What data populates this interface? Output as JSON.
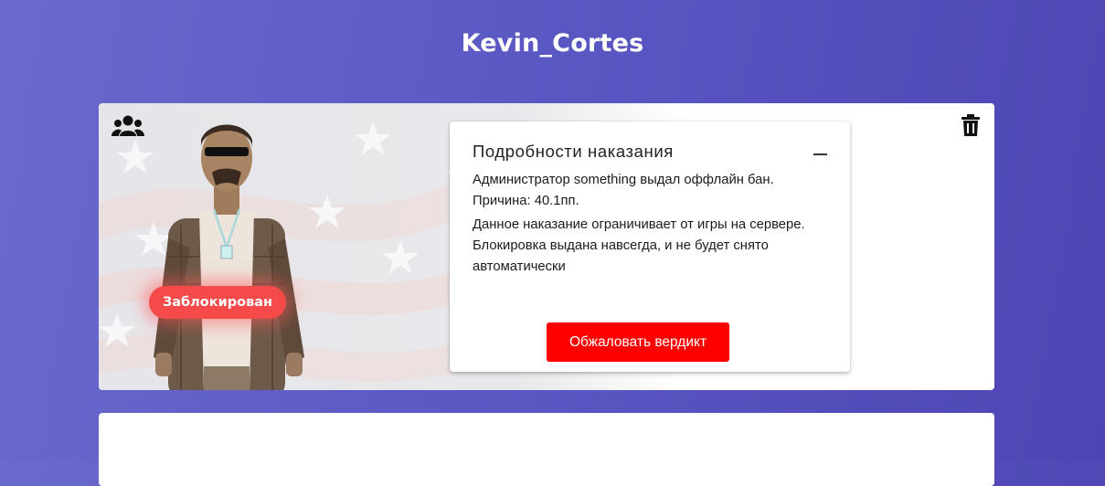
{
  "header": {
    "title": "Kevin_Cortes"
  },
  "profile": {
    "status_badge": "Заблокирован",
    "icons": {
      "group": "users-group-icon",
      "delete": "trash-icon",
      "collapse": "minus-icon"
    }
  },
  "punishment": {
    "title": "Подробности наказания",
    "line1": "Администратор something выдал оффлайн бан. Причина: 40.1пп.",
    "line2": "Данное наказание ограничивает от игры на сервере. Блокировка выдана навсегда, и не будет снято автоматически",
    "appeal_button": "Обжаловать вердикт"
  },
  "colors": {
    "background_start": "#6a6acc",
    "background_end": "#4d45b3",
    "badge": "#f44a4a",
    "button": "#ff0000"
  }
}
